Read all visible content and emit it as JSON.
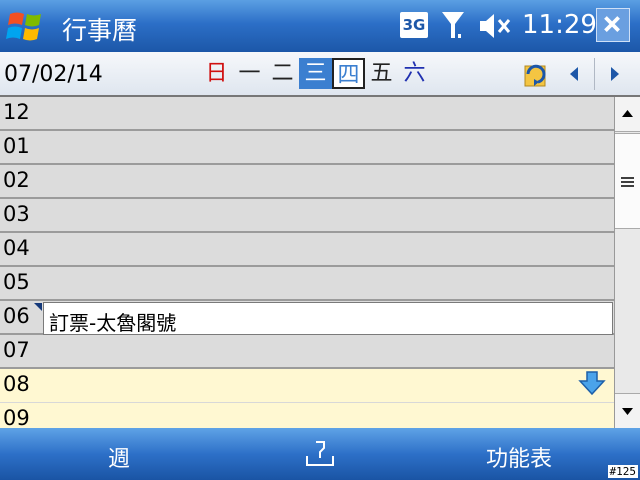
{
  "title_bar": {
    "app_title": "行事曆",
    "network_label": "3G",
    "clock": "11:29",
    "icons": [
      "windows-start-icon",
      "signal-icon",
      "volume-muted-icon",
      "close-icon"
    ]
  },
  "toolbar": {
    "date": "07/02/14",
    "weekdays": [
      "日",
      "一",
      "二",
      "三",
      "四",
      "五",
      "六"
    ],
    "selected_weekday": "三",
    "today_weekday": "四",
    "icons": [
      "go-to-today-icon",
      "previous-arrow-icon",
      "next-arrow-icon"
    ]
  },
  "day_view": {
    "hours": [
      "12",
      "01",
      "02",
      "03",
      "04",
      "05",
      "06",
      "07",
      "08",
      "09"
    ],
    "appointment": {
      "hour": "06",
      "text": "訂票-太魯閣號"
    },
    "work_hours_start": "08"
  },
  "softkeys": {
    "left": "週",
    "right": "功能表"
  },
  "corner_tag": "#125",
  "colors": {
    "title_bar": "#2c6fc7",
    "selected_day": "#3b7fd0",
    "work_hours_bg": "#fff8d2",
    "off_hours_bg": "#dcdcdc"
  }
}
